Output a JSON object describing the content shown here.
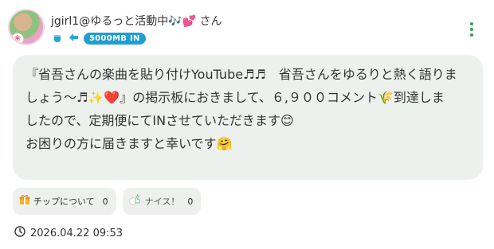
{
  "post": {
    "username": "jgirl1@ゆるっと活動中🎶💕 さん",
    "data_badge": "5000MB IN",
    "message_lines": [
      "『省吾さんの楽曲を貼り付けYouTube♬♬　省吾さんをゆるりと熱く語りま",
      "しょう〜♬✨❤️』の掲示板におきまして、６,９００コメント🌾到達しま",
      "したので、定期便にてINさせていただきます😊",
      "お困りの方に届きますと幸いです🤗"
    ],
    "tip_button": {
      "label": "チップについて",
      "count": "0"
    },
    "nice_button": {
      "label": "ナイス！",
      "count": "0"
    },
    "timestamp": "2026.04.22 09:53"
  },
  "icons": [
    "avatar",
    "cup-icon",
    "arrow-icon",
    "kebab-menu-icon",
    "gift-icon",
    "nice-hand-icon",
    "clock-icon"
  ],
  "colors": {
    "accent_blue": "#1f9fd1",
    "kebab_green": "#2aa64a",
    "bubble_bg": "#edf1ee"
  }
}
